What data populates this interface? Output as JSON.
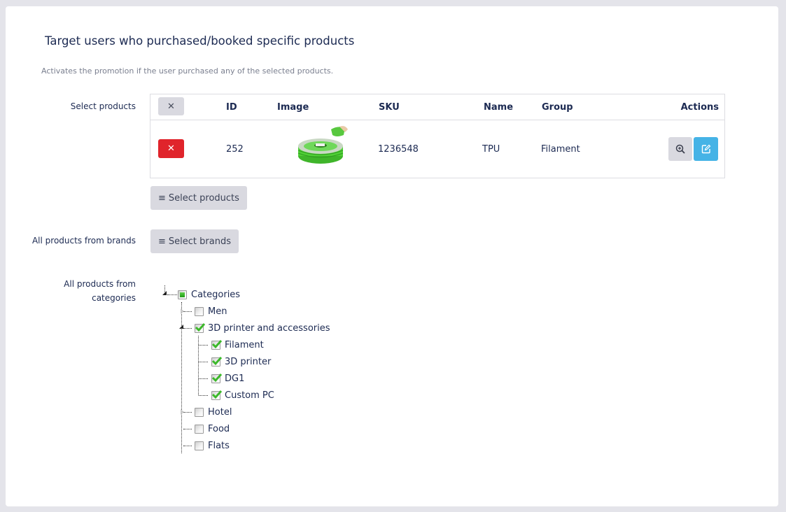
{
  "section": {
    "title": "Target users who purchased/booked specific products",
    "subtitle": "Activates the promotion if the user purchased any of the selected products."
  },
  "products": {
    "label": "Select products",
    "columns": [
      "ID",
      "Image",
      "SKU",
      "Name",
      "Group",
      "Actions"
    ],
    "clear_all_icon": "close-icon",
    "rows": [
      {
        "id": "252",
        "image": "green TPU filament spool",
        "sku": "1236548",
        "name": "TPU",
        "group": "Filament"
      }
    ],
    "select_button": "Select products"
  },
  "brands": {
    "label": "All products from brands",
    "select_button": "Select brands"
  },
  "categories": {
    "label_line1": "All products from",
    "label_line2": "categories",
    "tree": [
      {
        "label": "Categories",
        "state": "partial",
        "expanded": true,
        "level": 0
      },
      {
        "label": "Men",
        "state": "unchecked",
        "expanded": false,
        "level": 1
      },
      {
        "label": "3D printer and accessories",
        "state": "checked",
        "expanded": true,
        "level": 1
      },
      {
        "label": "Filament",
        "state": "checked",
        "level": 2
      },
      {
        "label": "3D printer",
        "state": "checked",
        "level": 2
      },
      {
        "label": "DG1",
        "state": "checked",
        "level": 2
      },
      {
        "label": "Custom PC",
        "state": "checked",
        "level": 2
      },
      {
        "label": "Hotel",
        "state": "unchecked",
        "expanded": false,
        "level": 1
      },
      {
        "label": "Food",
        "state": "unchecked",
        "level": 1
      },
      {
        "label": "Flats",
        "state": "unchecked",
        "level": 1
      }
    ]
  },
  "colors": {
    "danger": "#e0242b",
    "info": "#45b3e6",
    "neutral": "#d9d9e0",
    "text": "#1c2a52"
  }
}
